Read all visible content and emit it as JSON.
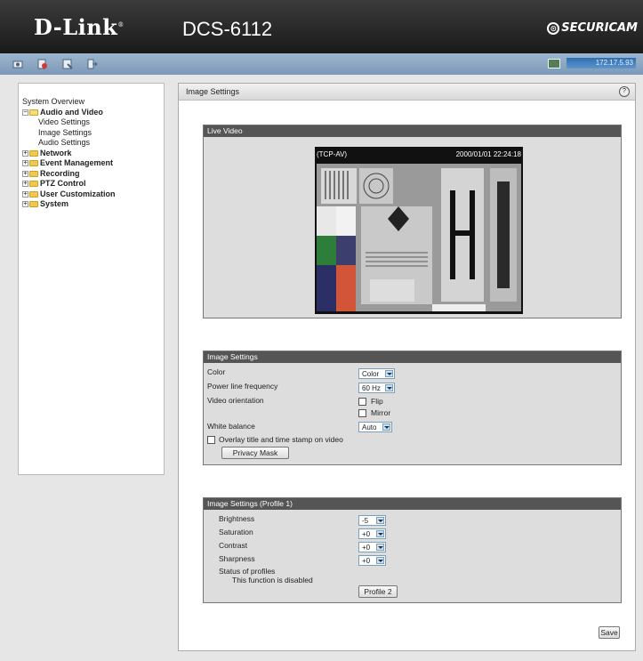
{
  "header": {
    "logo": "D-Link",
    "logo_mark": "®",
    "model": "DCS-6112",
    "brand": "SECURICAM",
    "brand_mark": "⊙"
  },
  "toolbar": {
    "icons": [
      "snapshot-icon",
      "record-icon",
      "settings-icon",
      "logout-icon"
    ],
    "ip": "172.17.5.93"
  },
  "sidebar": {
    "title": "System Overview",
    "items": [
      {
        "label": "Audio and Video",
        "expanded": true,
        "children": [
          "Video Settings",
          "Image Settings",
          "Audio Settings"
        ]
      },
      {
        "label": "Network",
        "expanded": false
      },
      {
        "label": "Event Management",
        "expanded": false
      },
      {
        "label": "Recording",
        "expanded": false
      },
      {
        "label": "PTZ Control",
        "expanded": false
      },
      {
        "label": "User Customization",
        "expanded": false
      },
      {
        "label": "System",
        "expanded": false
      }
    ]
  },
  "main": {
    "title": "Image Settings",
    "help": "?",
    "live_video": {
      "heading": "Live Video",
      "stream": "(TCP-AV)",
      "timestamp": "2000/01/01 22:24:18"
    },
    "image_settings": {
      "heading": "Image Settings",
      "color_label": "Color",
      "color_value": "Color",
      "power_label": "Power line frequency",
      "power_value": "60 Hz",
      "orientation_label": "Video orientation",
      "flip_label": "Flip",
      "mirror_label": "Mirror",
      "wb_label": "White balance",
      "wb_value": "Auto",
      "overlay_label": "Overlay title and time stamp on video",
      "privacy_button": "Privacy Mask"
    },
    "profile": {
      "heading": "Image Settings (Profile 1)",
      "brightness_label": "Brightness",
      "brightness_value": "-5",
      "saturation_label": "Saturation",
      "saturation_value": "+0",
      "contrast_label": "Contrast",
      "contrast_value": "+0",
      "sharpness_label": "Sharpness",
      "sharpness_value": "+0",
      "status_label": "Status of profiles",
      "status_text": "This function is disabled",
      "profile_button": "Profile 2"
    },
    "save_button": "Save"
  },
  "colors": {
    "toolbar": "#8ca8c4",
    "section_head": "#555555",
    "ip_box": "#3f7fbf"
  }
}
